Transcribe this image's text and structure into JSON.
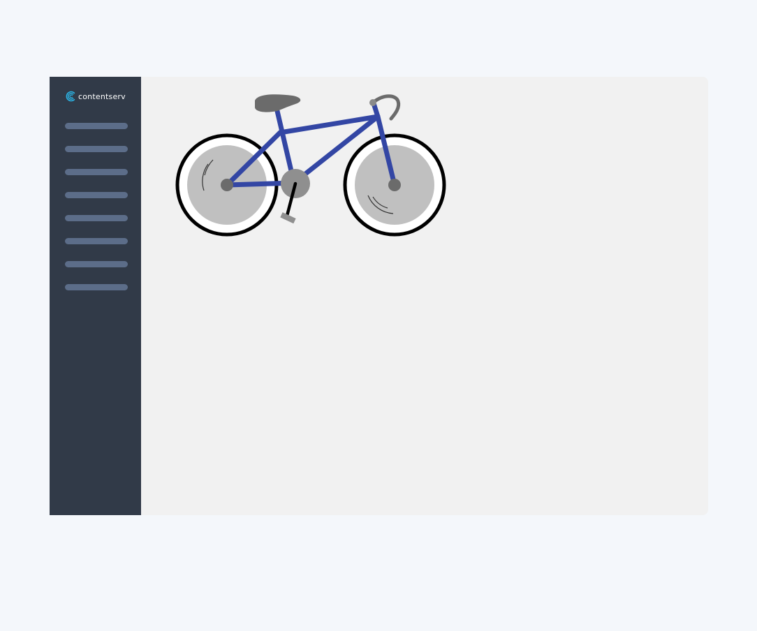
{
  "app": {
    "brand": {
      "name": "contentserv",
      "logo_icon": "contentserv-logo-icon",
      "logo_color": "#2bb6e8"
    }
  },
  "sidebar": {
    "background": "#313a48",
    "item_color": "#5c6d89",
    "items": [
      {
        "label": ""
      },
      {
        "label": ""
      },
      {
        "label": ""
      },
      {
        "label": ""
      },
      {
        "label": ""
      },
      {
        "label": ""
      },
      {
        "label": ""
      },
      {
        "label": ""
      }
    ]
  },
  "main": {
    "illustration": {
      "icon": "bicycle-icon",
      "frame_color": "#3346a4",
      "tire_color": "#000000",
      "wheel_color": "#c0c0c0",
      "part_color": "#6b6b6b"
    }
  }
}
